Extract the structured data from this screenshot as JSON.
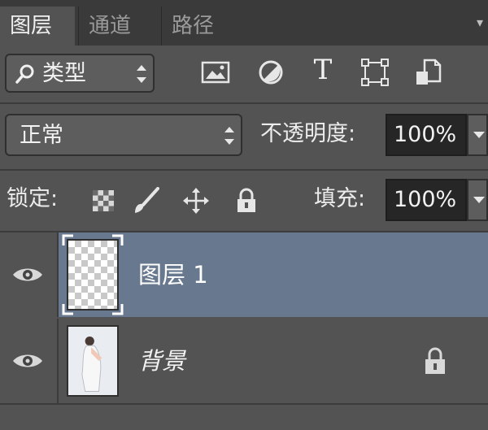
{
  "tabs": [
    {
      "label": "图层",
      "active": true
    },
    {
      "label": "通道",
      "active": false
    },
    {
      "label": "路径",
      "active": false
    }
  ],
  "filter": {
    "kind_label": "类型",
    "icons": [
      "image-filter-icon",
      "adjustment-filter-icon",
      "text-filter-icon",
      "shape-filter-icon",
      "smart-object-filter-icon"
    ],
    "text_icon_glyph": "T"
  },
  "blend": {
    "mode": "正常",
    "opacity_label": "不透明度:",
    "opacity_value": "100%"
  },
  "lock": {
    "label": "锁定:",
    "fill_label": "填充:",
    "fill_value": "100%"
  },
  "layers": [
    {
      "name": "图层 1",
      "visible": true,
      "selected": true,
      "thumbnail": "transparent-checker"
    },
    {
      "name": "背景",
      "visible": true,
      "selected": false,
      "locked": true,
      "thumbnail": "photo-woman"
    }
  ],
  "colors": {
    "panel_bg": "#535353",
    "tabbar_bg": "#3a3a3a",
    "selected_layer": "#68788e",
    "field_bg": "#262626"
  }
}
